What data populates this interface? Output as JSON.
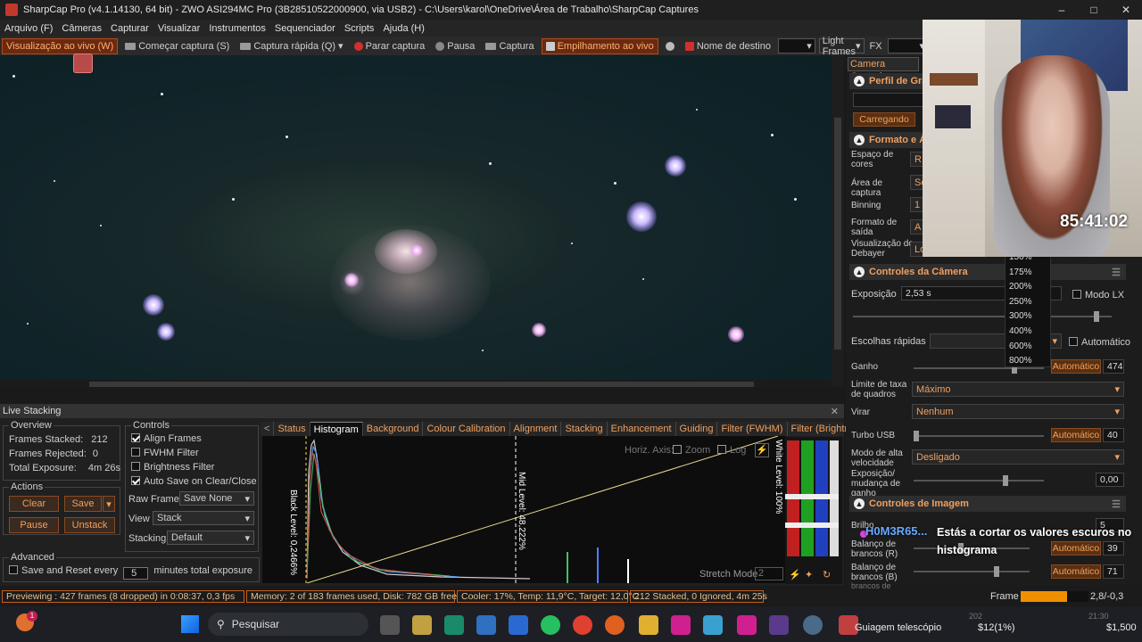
{
  "window": {
    "title": "SharpCap Pro (v4.1.14130, 64 bit) - ZWO ASI294MC Pro (3B28510522000900, via USB2) - C:\\Users\\karol\\OneDrive\\Área de Trabalho\\SharpCap Captures"
  },
  "menu": [
    "Arquivo (F)",
    "Câmeras",
    "Capturar",
    "Visualizar",
    "Instrumentos",
    "Sequenciador",
    "Scripts",
    "Ajuda (H)"
  ],
  "toolbar": {
    "live_view": "Visualização ao vivo (W)",
    "start_capture": "Começar captura (S)",
    "quick_capture": "Captura rápida (Q)",
    "stop_capture": "Parar captura",
    "pause": "Pausa",
    "capture": "Captura",
    "live_stack": "Empilhamento ao vivo",
    "target_name": "Nome de destino",
    "frame_type": "Light Frames",
    "fx": "FX"
  },
  "live_stacking": {
    "title": "Live Stacking",
    "overview": {
      "label": "Overview",
      "frames_stacked_label": "Frames Stacked:",
      "frames_stacked": "212",
      "frames_rejected_label": "Frames Rejected:",
      "frames_rejected": "0",
      "total_exposure_label": "Total Exposure:",
      "total_exposure": "4m 26s"
    },
    "actions": {
      "label": "Actions",
      "clear": "Clear",
      "save": "Save",
      "pause": "Pause",
      "unstack": "Unstack"
    },
    "advanced": {
      "label": "Advanced",
      "save_reset": "Save and Reset every",
      "minutes_value": "5",
      "minutes_label": "minutes total exposure"
    },
    "controls": {
      "label": "Controls",
      "align_frames": "Align Frames",
      "fwhm_filter": "FWHM Filter",
      "brightness_filter": "Brightness Filter",
      "auto_save": "Auto Save on Clear/Close",
      "raw_frames_label": "Raw Frames",
      "raw_frames_value": "Save None",
      "view_label": "View",
      "view_value": "Stack",
      "stacking_label": "Stacking",
      "stacking_value": "Default"
    },
    "tabs": [
      "Status",
      "Histogram",
      "Background",
      "Colour Calibration",
      "Alignment",
      "Stacking",
      "Enhancement",
      "Guiding",
      "Filter (FWHM)",
      "Filter (Brightness)",
      "D"
    ],
    "histogram": {
      "horiz_axis": "Horiz. Axis:",
      "zoom": "Zoom",
      "log": "Log",
      "black_level": "Black Level: 0,2466%",
      "mid_level": "Mid Level: 48,222%",
      "white_level": "White Level: 100%",
      "stretch_mode": "Stretch Mode",
      "stretch_value": "2"
    }
  },
  "status_bar": {
    "previewing": "Previewing : 427 frames (8 dropped) in 0:08:37, 0,3 fps",
    "memory": "Memory: 2 of 183 frames used, Disk: 782 GB free",
    "cooler": "Cooler: 17%, Temp: 11,9°C, Target: 12,0°C",
    "stacked": "212 Stacked, 0 Ignored, 4m 25s",
    "frame_label": "Frame :",
    "frame_progress": 0.68,
    "coords": "2,8/-0,3"
  },
  "camera_controls": {
    "tab": "Camera Controls",
    "profile_header": "Perfil de Grav",
    "loading": "Carregando",
    "format_header": "Formato e Ár",
    "color_space": "Espaço de cores",
    "color_space_value": "R",
    "capture_area": "Área de captura",
    "capture_area_value": "Se",
    "binning": "Binning",
    "binning_value": "1",
    "output_format": "Formato de saída",
    "output_format_value": "A",
    "debayer_preview": "Visualização do Debayer",
    "debayer_value": "Lo",
    "camera_header": "Controles da Câmera",
    "exposure": "Exposição",
    "exposure_value": "2,53 s",
    "lx_mode": "Modo LX",
    "quick_choices": "Escolhas rápidas",
    "auto": "Automático",
    "gain": "Ganho",
    "gain_auto": "Automático",
    "gain_value": "474",
    "frame_rate_limit": "Limite de taxa de quadros",
    "frame_rate_value": "Máximo",
    "flip": "Virar",
    "flip_value": "Nenhum",
    "usb_turbo": "Turbo USB",
    "usb_auto": "Automático",
    "usb_value": "40",
    "high_speed": "Modo de alta velocidade",
    "high_speed_value": "Desligado",
    "exposure_gain_change": "Exposição/ mudança de ganho",
    "exposure_gain_value": "0,00",
    "image_header": "Controles de Imagem",
    "brightness": "Brilho",
    "brightness_value": "5",
    "wb_red": "Balanço de brancos (R)",
    "wb_red_auto": "Automático",
    "wb_red_value": "39",
    "wb_blue": "Balanço de brancos (B)",
    "wb_blue_auto": "Automático",
    "wb_blue_value": "71",
    "cut_label": "brancos de"
  },
  "zoom_options": [
    "150%",
    "175%",
    "200%",
    "250%",
    "300%",
    "400%",
    "600%",
    "800%"
  ],
  "stream": {
    "timer": "85:41:02",
    "chat_user": "H0M3R65...",
    "chat_message": "Estás a cortar os valores escuros no histograma"
  },
  "taskbar": {
    "search": "Pesquisar",
    "active_app": "Guiagem telescópio",
    "notification_count": "1",
    "price1": "$12(1%)",
    "price2": "$1,500",
    "time_hint": "21:30",
    "date_hint": "202"
  },
  "colors": {
    "accent": "#f0a060",
    "border_orange": "#c06020",
    "panel": "#202020"
  }
}
